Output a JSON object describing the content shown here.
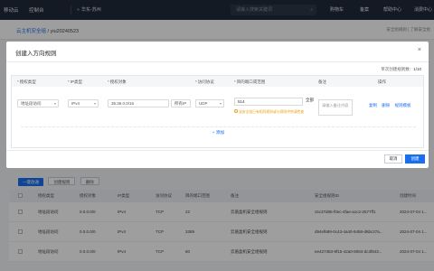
{
  "topbar": {
    "brand": "移动云",
    "console": "控制台",
    "region": "华东-苏州",
    "search_placeholder": "请输入搜索关键词",
    "nav": [
      "购物车",
      "备案",
      "帮助中心",
      "消费中心"
    ]
  },
  "breadcrumb": {
    "parent": "云主机安全组",
    "sep": " / ",
    "current": "yiu20240523"
  },
  "sub_right": "安全组规则 | 了解安全组",
  "modal": {
    "title": "创建入方向规则",
    "close": "×",
    "quota_label": "单次创建规则数：",
    "quota_value": "1/10",
    "columns": [
      "授权类型",
      "IP类型",
      "授权对象",
      "访问协议",
      "目的端口或范围",
      "备注",
      "操作"
    ],
    "row": {
      "auth_type": "地址段访问",
      "ip_type": "IPv4",
      "auth_object": "36.36.0.0/16",
      "object_kind": "所有IP",
      "protocol": "UDP",
      "ports": "514",
      "all_btn": "全部",
      "warning": "该安全组已有相同规则或与规则冲突请检查",
      "remark_placeholder": "请输入备注内容",
      "ops": [
        "复制",
        "删除",
        "规则模板"
      ]
    },
    "add_label": "+ 添加",
    "cancel_label": "取消",
    "ok_label": "创建"
  },
  "bg": {
    "buttons": [
      "一键放通",
      "创建规则",
      "删除"
    ],
    "headers": [
      "授权类型",
      "授权对象",
      "IP类型",
      "访问协议",
      "目的端口范围",
      "备注",
      "安全组规则ID",
      "创建时间"
    ],
    "rows": [
      {
        "auth": "地址段访问",
        "obj": "0.0.0.0/0",
        "ip": "IPv4",
        "proto": "TCP",
        "port": "22",
        "remark": "云盾盒机安全组规则",
        "id": "c5c37d85-f0ec-4fae-a1c2-2577ff1",
        "time": "2024-07-04 1..."
      },
      {
        "auth": "地址段访问",
        "obj": "0.0.0.0/0",
        "ip": "IPv4",
        "proto": "TCP",
        "port": "3389",
        "remark": "云盾盒机安全组规则",
        "id": "d94ef689-0c43-4a40-9458-d6bc27a...",
        "time": "2024-07-04 1..."
      },
      {
        "auth": "地址段访问",
        "obj": "0.0.0.0/0",
        "ip": "IPv4",
        "proto": "TCP",
        "port": "80",
        "remark": "云盾盒机安全组规则",
        "id": "ee427383-9f15-42a0-8084-dc3f843...",
        "time": "2024-07-04 1..."
      }
    ]
  },
  "colors": {
    "primary": "#1a6ff0",
    "warning": "#e8a317",
    "topbar": "#1f2a3a"
  }
}
